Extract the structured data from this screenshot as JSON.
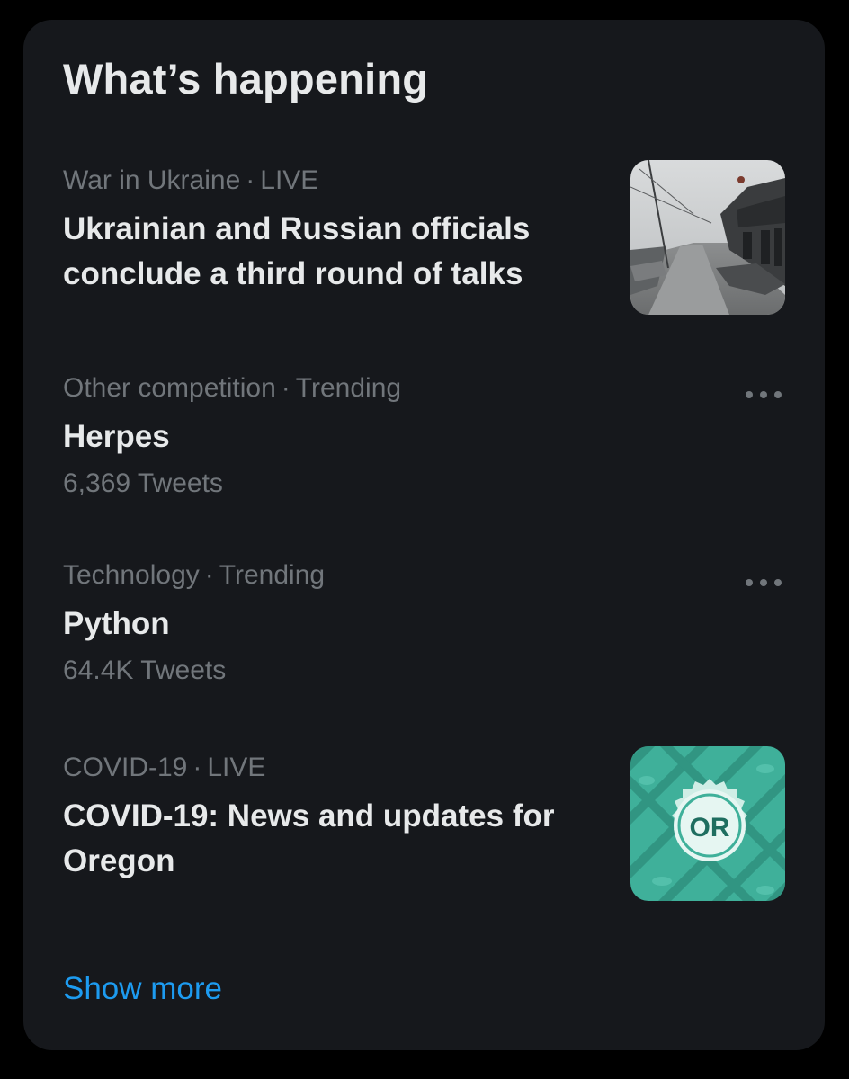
{
  "panel": {
    "title": "What’s happening",
    "show_more_label": "Show more"
  },
  "trends": [
    {
      "category": "War in Ukraine",
      "separator": "·",
      "status": "LIVE",
      "title": "Ukrainian and Russian officials conclude a third round of talks",
      "thumbnail": "street-photo"
    },
    {
      "category": "Other competition",
      "separator": "·",
      "status": "Trending",
      "title": "Herpes",
      "count": "6,369 Tweets",
      "more_icon": "more-horizontal-icon"
    },
    {
      "category": "Technology",
      "separator": "·",
      "status": "Trending",
      "title": "Python",
      "count": "64.4K Tweets",
      "more_icon": "more-horizontal-icon"
    },
    {
      "category": "COVID-19",
      "separator": "·",
      "status": "LIVE",
      "title": "COVID-19: News and updates for Oregon",
      "thumbnail": "oregon-badge",
      "badge_text": "OR"
    }
  ],
  "colors": {
    "background": "#000000",
    "panel": "#16181c",
    "primary_text": "#e7e9ea",
    "secondary_text": "#71767b",
    "accent": "#1d9bf0",
    "badge_teal": "#3fb09a"
  }
}
